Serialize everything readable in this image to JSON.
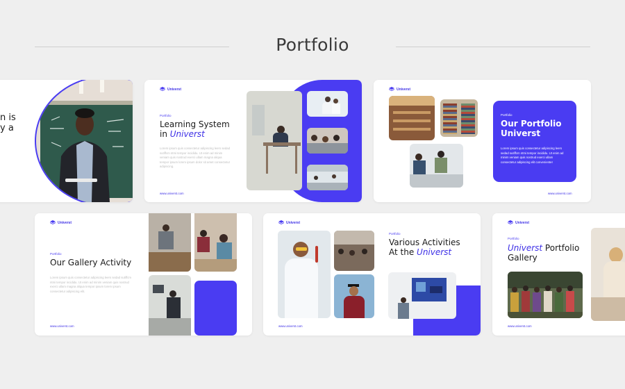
{
  "header": {
    "title": "Portfolio"
  },
  "brand": {
    "name": "Universt",
    "url": "www.universt.com",
    "accent": "#4a3cf2"
  },
  "slide1": {
    "title_partial_1": "n is",
    "title_partial_2": "y a"
  },
  "slide2": {
    "eyebrow": "Portfolio",
    "title_1": "Learning System",
    "title_2_prefix": "in ",
    "title_2_accent": "Universt",
    "body": "Lorem ipsum quis consectetur adipiscing leers sedad sutiffcm ntmi tempor incididu. Ut enim ad minim veniam quis nostrud exerci ullam magna aliqua tempor ipsum lorem ipsum dolor sit amet consectetur adipiscing."
  },
  "slide3": {
    "eyebrow": "Portfolio",
    "title_1": "Our Portfolio",
    "title_2": "Universt",
    "body": "Lorem ipsum quis consectetur adipiscing leers sedad sutiffcm ntmi tempor incididu. Ut enim ad minim veniam quis nostrud exerci ullam consectetur adipiscing elit convenienter"
  },
  "slide4": {
    "eyebrow": "Portfolio",
    "title": "Our Gallery Activity",
    "body": "Lorem ipsum quis consectetur adipiscing leers sedad sutiffcm ntmi tempor incididu. Ut enim ad minim veniam quis nostrud exerci ullam magna aliqua tempor ipsum lorem ipsum consectetur adipiscing elit."
  },
  "slide5": {
    "eyebrow": "Portfolio",
    "title_1": "Various Activities",
    "title_2_prefix": "At the ",
    "title_2_accent": "Universt"
  },
  "slide6": {
    "eyebrow": "Portfolio",
    "title_1_accent": "Universt",
    "title_1_suffix": " Portfolio",
    "title_2": "Gallery"
  }
}
